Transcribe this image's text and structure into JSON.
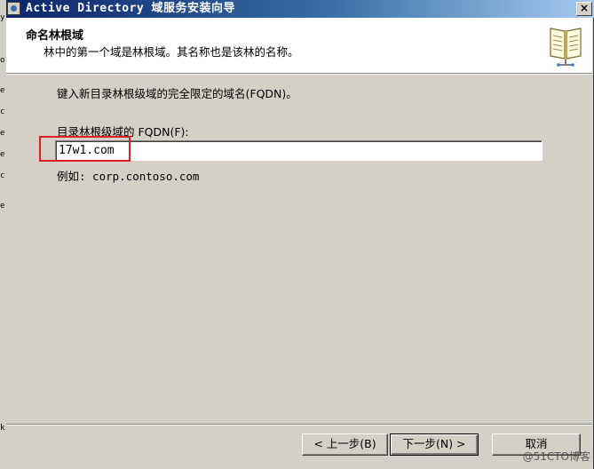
{
  "window": {
    "title": "Active Directory 域服务安装向导",
    "close_glyph": "×"
  },
  "left_window_fragments": [
    "y",
    "o",
    "e",
    "c",
    "e",
    "e",
    "c",
    "e",
    "k"
  ],
  "header": {
    "title": "命名林根域",
    "subtitle": "林中的第一个域是林根域。其名称也是该林的名称。",
    "icon": "book-icon"
  },
  "content": {
    "prompt": "键入新目录林根级域的完全限定的域名(FQDN)。",
    "fqdn_label": "目录林根级域的 FQDN(F):",
    "fqdn_value": "17w1.com",
    "example": "例如: corp.contoso.com"
  },
  "buttons": {
    "back": "< 上一步(B)",
    "next": "下一步(N) >",
    "cancel": "取消"
  },
  "watermark": "@51CTO博客",
  "colors": {
    "titlebar_start": "#0a246a",
    "titlebar_end": "#a6caf0",
    "dialog_face": "#d4d0c8",
    "highlight": "#e02020"
  }
}
